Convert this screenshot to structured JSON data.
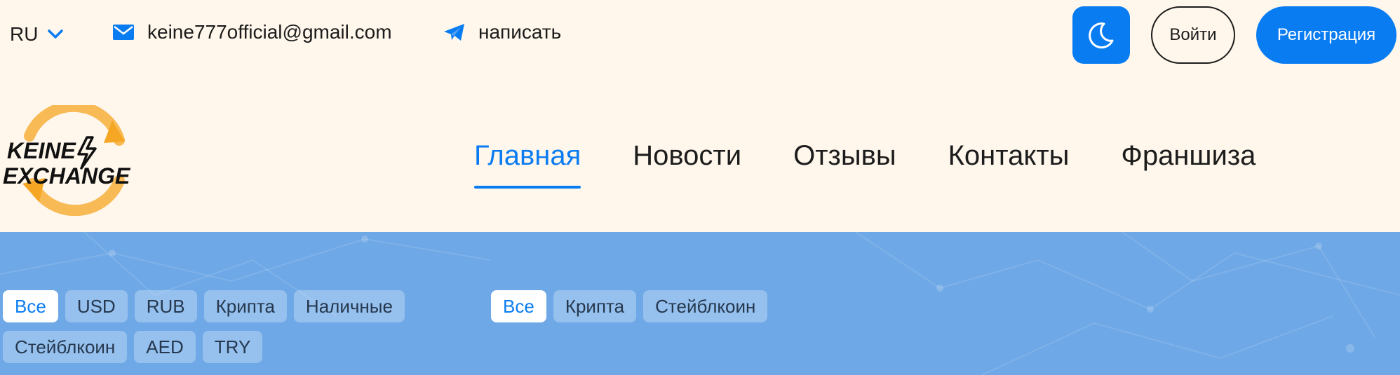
{
  "topbar": {
    "language": "RU",
    "email": "keine777official@gmail.com",
    "telegram_label": "написать",
    "login_label": "Войти",
    "register_label": "Регистрация"
  },
  "logo": {
    "line1": "KEINE",
    "line2": "EXCHANGE"
  },
  "nav": {
    "items": [
      {
        "label": "Главная",
        "active": true
      },
      {
        "label": "Новости",
        "active": false
      },
      {
        "label": "Отзывы",
        "active": false
      },
      {
        "label": "Контакты",
        "active": false
      },
      {
        "label": "Франшиза",
        "active": false
      }
    ]
  },
  "filters": {
    "give": [
      {
        "label": "Все",
        "active": true
      },
      {
        "label": "USD",
        "active": false
      },
      {
        "label": "RUB",
        "active": false
      },
      {
        "label": "Крипта",
        "active": false
      },
      {
        "label": "Наличные",
        "active": false
      },
      {
        "label": "Стейблкоин",
        "active": false
      },
      {
        "label": "AED",
        "active": false
      },
      {
        "label": "TRY",
        "active": false
      }
    ],
    "get": [
      {
        "label": "Все",
        "active": true
      },
      {
        "label": "Крипта",
        "active": false
      },
      {
        "label": "Стейблкоин",
        "active": false
      }
    ]
  },
  "colors": {
    "accent": "#0a7cf2",
    "header_bg": "#fff7ec",
    "hero_bg": "#6ea8e6",
    "logo_orange": "#f5a623"
  }
}
